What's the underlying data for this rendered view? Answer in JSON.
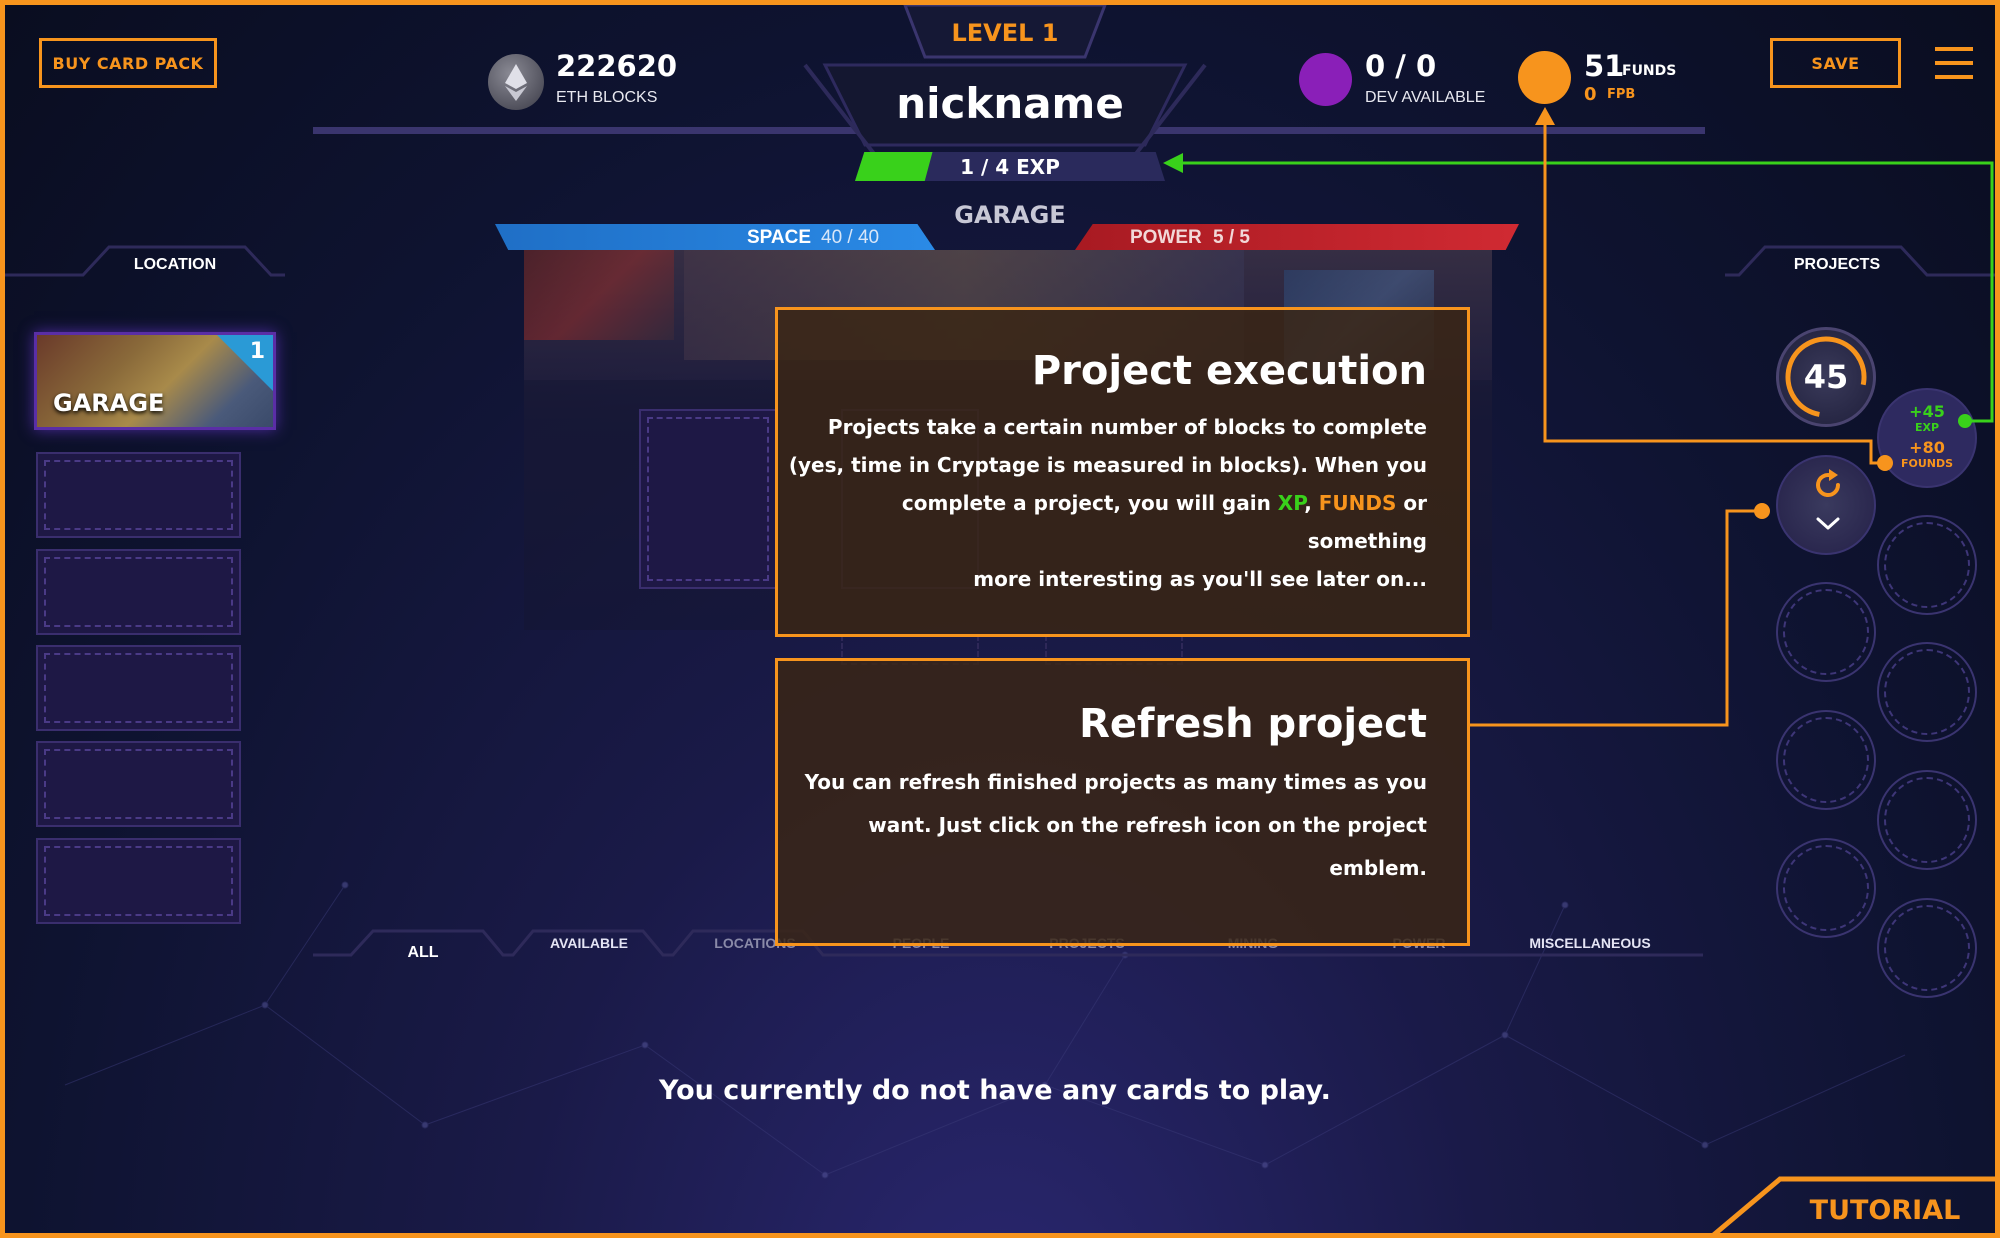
{
  "header": {
    "buy_card_pack": "BUY CARD PACK",
    "eth_blocks_value": "222620",
    "eth_blocks_label": "ETH BLOCKS",
    "level": "LEVEL 1",
    "nickname": "nickname",
    "exp_text": "1 / 4 EXP",
    "exp_progress": 0.25,
    "dev_value": "0 / 0",
    "dev_label": "DEV AVAILABLE",
    "funds_value": "51",
    "funds_label": "FUNDS",
    "fpb_value": "0",
    "fpb_label": "FPB",
    "save": "SAVE"
  },
  "location_panel": {
    "title": "LOCATION",
    "active_card": {
      "name": "GARAGE",
      "badge": "1"
    }
  },
  "garage": {
    "title": "GARAGE",
    "space_label": "SPACE",
    "space_value": "40 / 40",
    "power_label": "POWER",
    "power_value": "5 / 5"
  },
  "projects_panel": {
    "title": "PROJECTS",
    "project_value": "45",
    "reward_exp_value": "+45",
    "reward_exp_label": "EXP",
    "reward_funds_value": "+80",
    "reward_funds_label": "FOUNDS"
  },
  "tutorial_tips": {
    "execution": {
      "title": "Project execution",
      "line1": "Projects take a certain number of blocks to complete",
      "line2": "(yes, time in Cryptage is measured in blocks). When you",
      "line3_pre": "complete a project, you will gain ",
      "line3_xp": "XP",
      "line3_mid": ", ",
      "line3_funds": "FUNDS",
      "line3_post": " or something",
      "line4": "more interesting as you'll see later on..."
    },
    "refresh": {
      "title": "Refresh project",
      "line1": "You can refresh finished projects as many times as you",
      "line2": "want. Just click on the refresh icon on the project emblem."
    }
  },
  "card_tabs": [
    "ALL",
    "AVAILABLE",
    "LOCATIONS",
    "PEOPLE",
    "PROJECTS",
    "MINING",
    "POWER",
    "MISCELLANEOUS"
  ],
  "empty_message": "You currently do not have any cards to play.",
  "tutorial_button": "TUTORIAL",
  "colors": {
    "accent": "#f7941d",
    "exp_green": "#39d11b",
    "space_blue": "#1f7fd6",
    "power_red": "#c8202a",
    "dev_purple": "#8a1fb8"
  }
}
